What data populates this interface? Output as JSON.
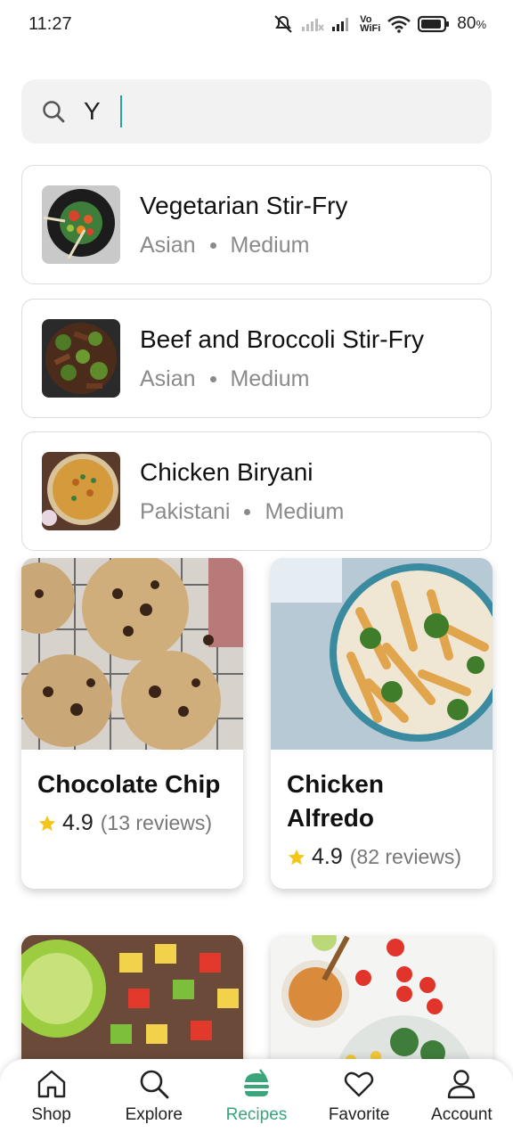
{
  "status_bar": {
    "time": "11:27",
    "vo_wifi_top": "Vo",
    "vo_wifi_bottom": "WiFi",
    "battery": "80",
    "battery_unit": "%"
  },
  "search": {
    "value": "Y",
    "icon": "search-icon"
  },
  "results": [
    {
      "title": "Vegetarian Stir-Fry",
      "cuisine": "Asian",
      "difficulty": "Medium"
    },
    {
      "title": "Beef and Broccoli Stir-Fry",
      "cuisine": "Asian",
      "difficulty": "Medium"
    },
    {
      "title": "Chicken Biryani",
      "cuisine": "Pakistani",
      "difficulty": "Medium"
    }
  ],
  "recipes": [
    {
      "title": "Chocolate Chip",
      "rating": "4.9",
      "reviews": "(13 reviews)"
    },
    {
      "title": "Chicken Alfredo",
      "rating": "4.9",
      "reviews": "(82 reviews)"
    }
  ],
  "nav": {
    "items": [
      {
        "label": "Shop",
        "icon": "home-icon"
      },
      {
        "label": "Explore",
        "icon": "search-icon"
      },
      {
        "label": "Recipes",
        "icon": "burger-icon",
        "active": true
      },
      {
        "label": "Favorite",
        "icon": "heart-icon"
      },
      {
        "label": "Account",
        "icon": "person-icon"
      }
    ]
  },
  "colors": {
    "accent": "#3aa47b",
    "star": "#f5c518",
    "caret": "#21a79b"
  }
}
